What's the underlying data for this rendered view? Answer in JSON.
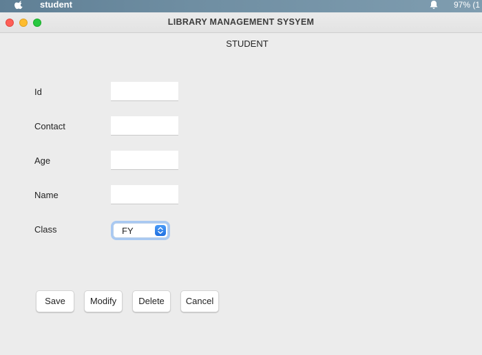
{
  "menubar": {
    "app_name": "student",
    "battery": "97% (1",
    "apple_icon": "apple-icon",
    "notification_icon": "bell-icon"
  },
  "window": {
    "title": "LIBRARY MANAGEMENT SYSYEM",
    "controls": {
      "close_color": "#fe5f57",
      "minimize_color": "#febc2e",
      "zoom_color": "#28c840"
    }
  },
  "form": {
    "heading": "STUDENT",
    "fields": {
      "id": {
        "label": "Id",
        "value": ""
      },
      "contact": {
        "label": "Contact",
        "value": ""
      },
      "age": {
        "label": "Age",
        "value": ""
      },
      "name": {
        "label": "Name",
        "value": ""
      }
    },
    "class": {
      "label": "Class",
      "selected": "FY"
    }
  },
  "buttons": {
    "save": "Save",
    "modify": "Modify",
    "delete": "Delete",
    "cancel": "Cancel"
  },
  "colors": {
    "accent": "#2f7ef0",
    "window_bg": "#ececec"
  }
}
